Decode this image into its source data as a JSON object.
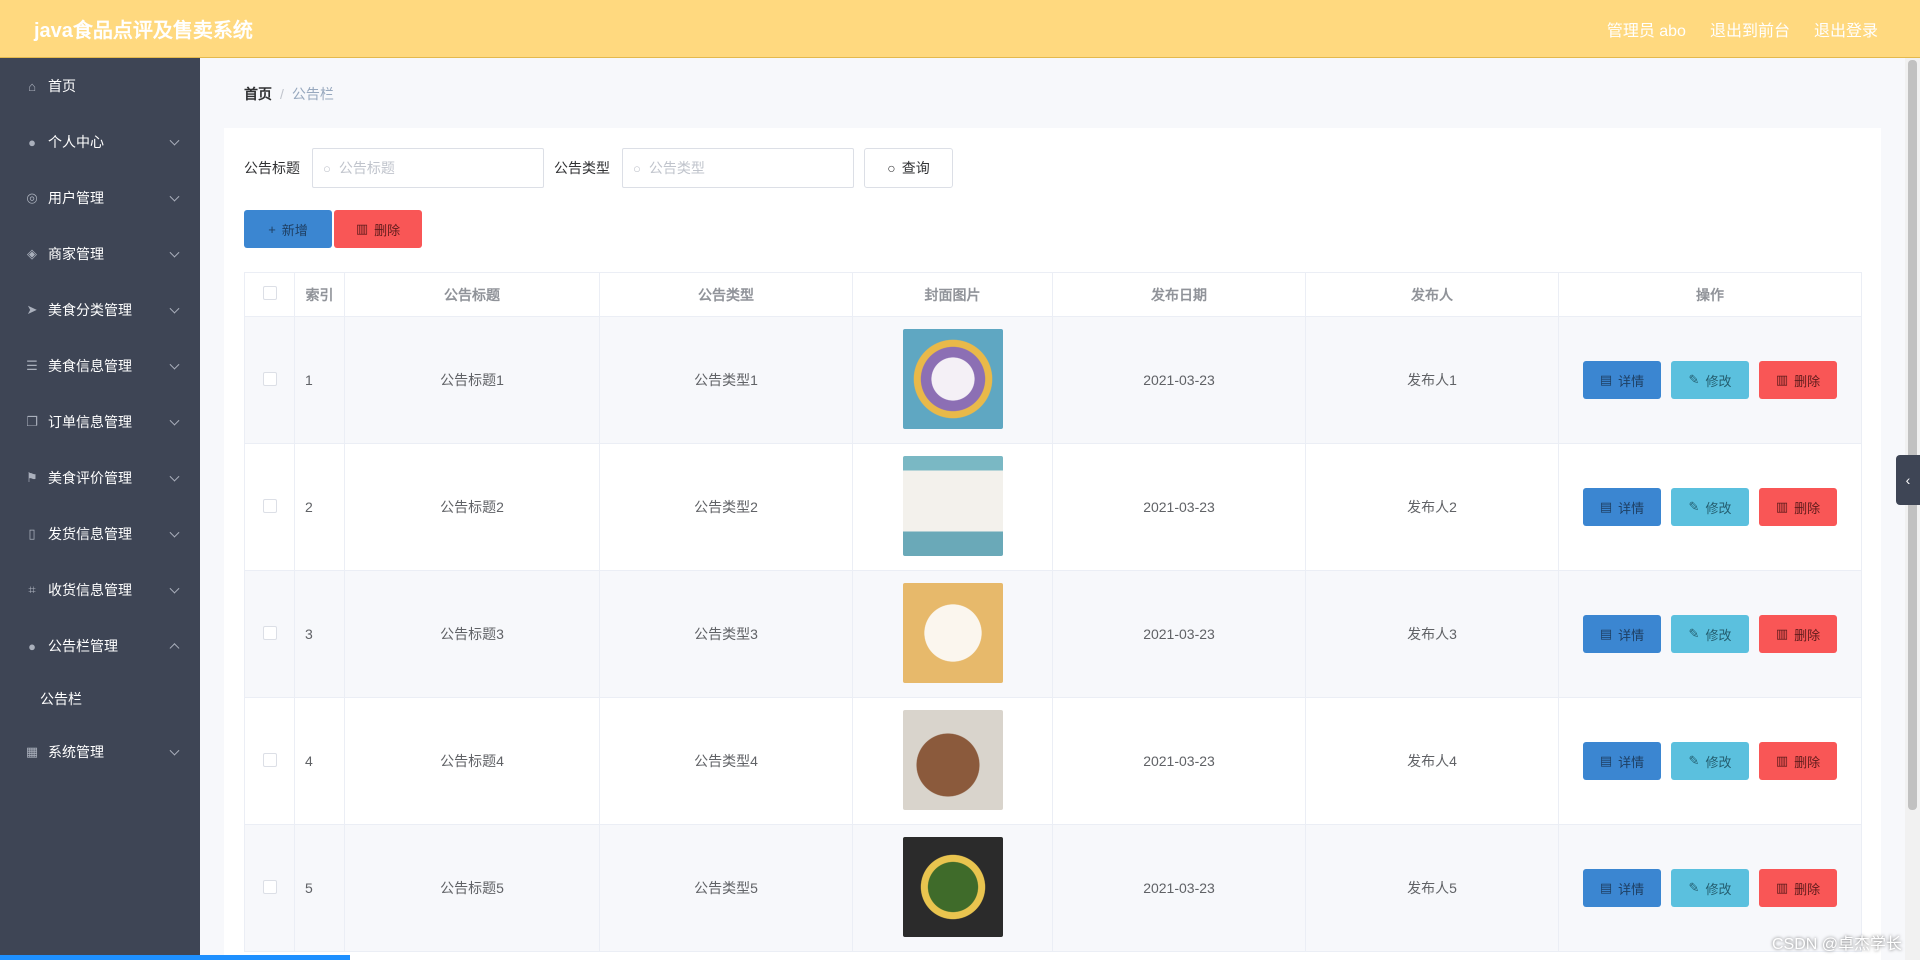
{
  "header": {
    "title": "java食品点评及售卖系统",
    "admin": "管理员 abo",
    "back_front": "退出到前台",
    "logout": "退出登录"
  },
  "sidebar": {
    "items": [
      {
        "label": "首页",
        "icon": "home-icon"
      },
      {
        "label": "个人中心",
        "icon": "user-icon"
      },
      {
        "label": "用户管理",
        "icon": "circle-icon"
      },
      {
        "label": "商家管理",
        "icon": "compass-icon"
      },
      {
        "label": "美食分类管理",
        "icon": "send-icon"
      },
      {
        "label": "美食信息管理",
        "icon": "list-icon"
      },
      {
        "label": "订单信息管理",
        "icon": "copy-icon"
      },
      {
        "label": "美食评价管理",
        "icon": "flag-icon"
      },
      {
        "label": "发货信息管理",
        "icon": "phone-icon"
      },
      {
        "label": "收货信息管理",
        "icon": "crop-icon"
      },
      {
        "label": "公告栏管理",
        "icon": "bulb-icon"
      },
      {
        "label": "系统管理",
        "icon": "grid-icon"
      }
    ],
    "subitem": "公告栏"
  },
  "breadcrumb": {
    "home": "首页",
    "separator": "/",
    "current": "公告栏"
  },
  "search": {
    "title_label": "公告标题",
    "title_placeholder": "公告标题",
    "type_label": "公告类型",
    "type_placeholder": "公告类型",
    "query_label": "查询"
  },
  "actions": {
    "add_label": "新增",
    "delete_label": "删除"
  },
  "table": {
    "columns": [
      "索引",
      "公告标题",
      "公告类型",
      "封面图片",
      "发布日期",
      "发布人",
      "操作"
    ],
    "rows": [
      {
        "index": "1",
        "title": "公告标题1",
        "type": "公告类型1",
        "date": "2021-03-23",
        "publisher": "发布人1"
      },
      {
        "index": "2",
        "title": "公告标题2",
        "type": "公告类型2",
        "date": "2021-03-23",
        "publisher": "发布人2"
      },
      {
        "index": "3",
        "title": "公告标题3",
        "type": "公告类型3",
        "date": "2021-03-23",
        "publisher": "发布人3"
      },
      {
        "index": "4",
        "title": "公告标题4",
        "type": "公告类型4",
        "date": "2021-03-23",
        "publisher": "发布人4"
      },
      {
        "index": "5",
        "title": "公告标题5",
        "type": "公告类型5",
        "date": "2021-03-23",
        "publisher": "发布人5"
      }
    ],
    "op_detail": "详情",
    "op_edit": "修改",
    "op_delete": "删除"
  },
  "watermark": "CSDN @卓杰学长",
  "colors": {
    "header_bg": "#ffd97f",
    "sidebar_bg": "#3e4555",
    "primary": "#3b86d1",
    "info": "#5bc0de",
    "danger": "#f95656"
  }
}
